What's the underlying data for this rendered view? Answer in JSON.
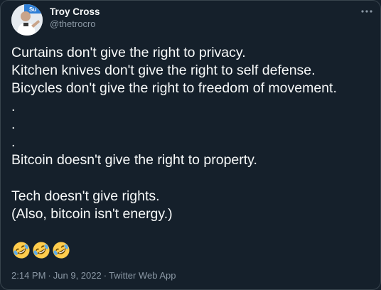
{
  "author": {
    "display_name": "Troy Cross",
    "handle": "@thetrocro",
    "avatar_badge_text": "Su"
  },
  "more_icon": "more-horizontal-icon",
  "tweet": {
    "lines": [
      "Curtains don't give the right to privacy.",
      "Kitchen knives don't give the right to self defense.",
      "Bicycles don't give the right to freedom of movement.",
      ".",
      ".",
      ".",
      "Bitcoin doesn't give the right to property.",
      "",
      "Tech doesn't give rights.",
      "(Also, bitcoin isn't energy.)"
    ],
    "emojis": [
      "rolling-on-floor-laughing-emoji",
      "rolling-on-floor-laughing-emoji",
      "rolling-on-floor-laughing-emoji"
    ]
  },
  "meta": {
    "time": "2:14 PM",
    "separator": "·",
    "date": "Jun 9, 2022",
    "source": "Twitter Web App"
  },
  "colors": {
    "background": "#15202b",
    "border": "#38444d",
    "text_primary": "#f7f9f9",
    "text_secondary": "#8b98a5"
  }
}
